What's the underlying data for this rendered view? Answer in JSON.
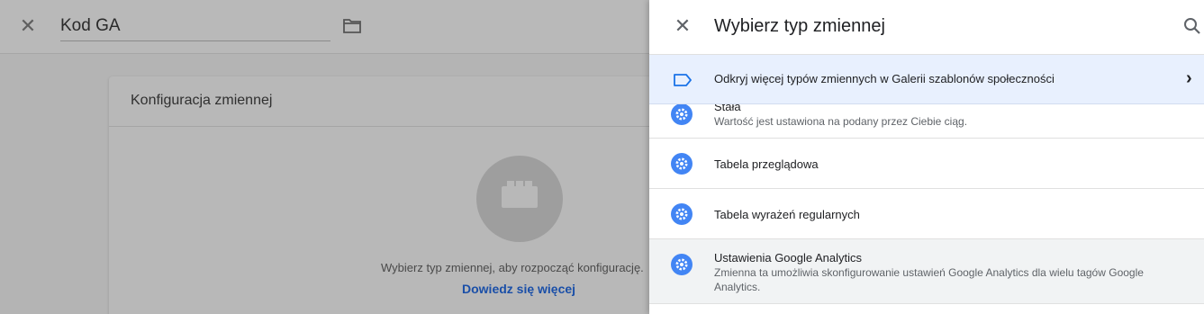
{
  "editor": {
    "title": "Kod GA",
    "card_title": "Konfiguracja zmiennej",
    "hint": "Wybierz typ zmiennej, aby rozpocząć konfigurację.",
    "learn_more": "Dowiedz się więcej"
  },
  "panel": {
    "title": "Wybierz typ zmiennej",
    "gallery_label": "Odkryj więcej typów zmiennych w Galerii szablonów społeczności",
    "items": [
      {
        "title": "Stała",
        "desc": "Wartość jest ustawiona na podany przez Ciebie ciąg."
      },
      {
        "title": "Tabela przeglądowa",
        "desc": ""
      },
      {
        "title": "Tabela wyrażeń regularnych",
        "desc": ""
      },
      {
        "title": "Ustawienia Google Analytics",
        "desc": "Zmienna ta umożliwia skonfigurowanie ustawień Google Analytics dla wielu tagów Google Analytics."
      }
    ]
  },
  "colors": {
    "accent": "#4285f4",
    "highlight": "#e8f0fe",
    "link": "#1a4fa8"
  }
}
